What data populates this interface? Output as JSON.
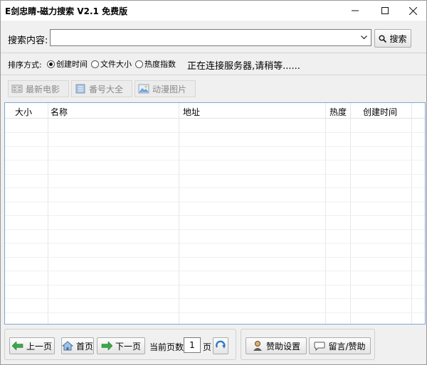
{
  "window": {
    "title": "E剑忠睛-磁力搜索 V2.1 免费版"
  },
  "search": {
    "label": "搜索内容:",
    "value": "",
    "button_label": "搜索"
  },
  "sort": {
    "label": "排序方式:",
    "options": [
      {
        "label": "创建时间",
        "selected": true
      },
      {
        "label": "文件大小",
        "selected": false
      },
      {
        "label": "热度指数",
        "selected": false
      }
    ],
    "status": "正在连接服务器,请稍等......"
  },
  "categories": [
    {
      "label": "最新电影",
      "icon": "film-icon"
    },
    {
      "label": "番号大全",
      "icon": "book-icon"
    },
    {
      "label": "动漫图片",
      "icon": "picture-icon"
    }
  ],
  "table": {
    "columns": [
      "大小",
      "名称",
      "地址",
      "热度",
      "创建时间"
    ],
    "rows": []
  },
  "pager": {
    "prev_label": "上一页",
    "home_label": "首页",
    "next_label": "下一页",
    "current_page_label": "当前页数:",
    "current_page": "1",
    "page_suffix": "页"
  },
  "support": {
    "donate_settings_label": "赞助设置",
    "message_label": "留言/赞助"
  },
  "colors": {
    "table_border": "#7fa7d4",
    "arrow_green": "#3aa84a",
    "refresh_blue": "#2f78c8"
  }
}
